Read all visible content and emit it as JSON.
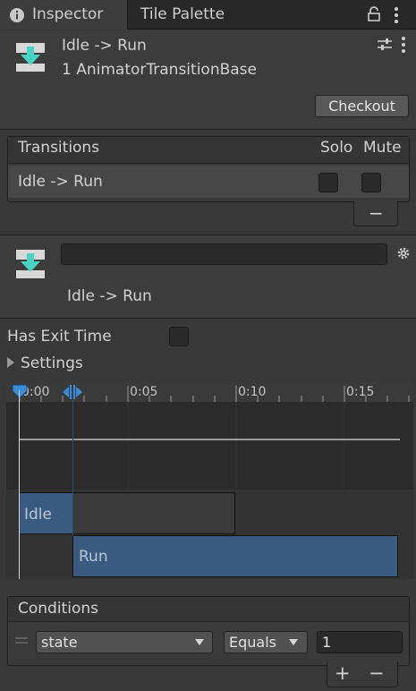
{
  "tabs": [
    {
      "label": "Inspector",
      "icon": "info-icon",
      "active": true
    },
    {
      "label": "Tile Palette",
      "active": false
    }
  ],
  "header": {
    "title": "Idle -> Run",
    "subtitle": "1 AnimatorTransitionBase",
    "checkout_label": "Checkout",
    "icon": "transition-icon"
  },
  "transitions": {
    "header": "Transitions",
    "solo_label": "Solo",
    "mute_label": "Mute",
    "rows": [
      {
        "name": "Idle -> Run",
        "solo": false,
        "mute": false
      }
    ],
    "remove_label": "−"
  },
  "transition": {
    "name_field": "",
    "label": "Idle -> Run"
  },
  "settings": {
    "has_exit_time_label": "Has Exit Time",
    "has_exit_time": false,
    "settings_label": "Settings"
  },
  "timeline": {
    "ticks": [
      "0:00",
      "0:05",
      "0:10",
      "0:15"
    ],
    "idle_label": "Idle",
    "run_label": "Run"
  },
  "conditions": {
    "header": "Conditions",
    "parameter": "state",
    "mode": "Equals",
    "value": "1",
    "add_label": "+",
    "remove_label": "−"
  },
  "colors": {
    "background": "#383838",
    "accent": "#3d8bd6",
    "clip_blue": "#3b5a80",
    "icon_teal": "#4ad3c4"
  }
}
